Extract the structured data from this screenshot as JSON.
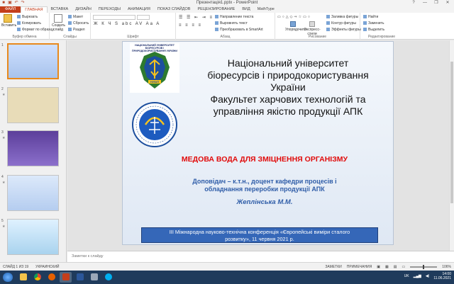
{
  "window": {
    "title": "Презентація1.pptx - PowerPoint",
    "help": "?",
    "min": "—",
    "max": "❐",
    "close": "✕"
  },
  "tabs": [
    "ФАЙЛ",
    "ГЛАВНАЯ",
    "ВСТАВКА",
    "ДИЗАЙН",
    "ПЕРЕХОДЫ",
    "АНИМАЦИЯ",
    "ПОКАЗ СЛАЙДОВ",
    "РЕЦЕНЗИРОВАНИЕ",
    "ВИД",
    "MathType"
  ],
  "ribbon": {
    "clipboard": {
      "paste": "Вставить",
      "cut": "Вырезать",
      "copy": "Копировать",
      "format": "Формат по образцу",
      "label": "Буфер обмена"
    },
    "slides": {
      "new_slide": "Создать слайд",
      "layout": "Макет",
      "reset": "Сбросить",
      "section": "Раздел",
      "label": "Слайды"
    },
    "font": {
      "label": "Шрифт",
      "format_row": "Ж К Ч S abc AV Aa A"
    },
    "paragraph": {
      "direction": "Направление текста",
      "align": "Выровнять текст",
      "smartart": "Преобразовать в SmartArt",
      "label": "Абзац"
    },
    "drawing": {
      "arrange": "Упорядочить",
      "styles": "Экспресс-стили",
      "fill": "Заливка фигуры",
      "outline": "Контур фигуры",
      "effects": "Эффекты фигуры",
      "label": "Рисование"
    },
    "editing": {
      "find": "Найти",
      "replace": "Заменить",
      "select": "Выделить",
      "label": "Редактирование"
    }
  },
  "thumbnails": [
    {
      "num": "1",
      "star": ""
    },
    {
      "num": "2",
      "star": "★"
    },
    {
      "num": "3",
      "star": "★"
    },
    {
      "num": "4",
      "star": "★"
    },
    {
      "num": "5",
      "star": "★"
    }
  ],
  "slide": {
    "logo1_text": "НАЦІОНАЛЬНИЙ УНІВЕРСИТЕТ БІОРЕСУРСІВ І ПРИРОДОКОРИСТУВАННЯ УКРАЇНИ",
    "logo1_badge": "НУБіП",
    "title_lines": [
      "Національний університет",
      "біоресурсів і природокористування",
      "України",
      "Факультет харчових технологій та",
      "управління якістю продукції АПК"
    ],
    "topic": "МЕДОВА ВОДА ДЛЯ ЗМІЦНЕННЯ ОРГАНІЗМУ",
    "speaker_lines": [
      "Доповідач – к.т.н., доцент кафедри процесів і",
      "обладнання переробки продукції АПК"
    ],
    "speaker_name": "Жеплінська М.М.",
    "conference_lines": [
      "ІІІ Міжнародна науково-технічна конференція «Європейські виміри сталого",
      "розвитку», 11 червня 2021 р."
    ]
  },
  "notes_placeholder": "Заметки к слайду",
  "status": {
    "slide": "СЛАЙД 1 ИЗ 19",
    "language": "УКРАИНСКИЙ",
    "notes_btn": "ЗАМЕТКИ",
    "comments_btn": "ПРИМЕЧАНИЯ",
    "zoom": "106%"
  },
  "taskbar": {
    "lang": "UK",
    "time": "14:00",
    "date": "11.06.2021"
  },
  "colors": {
    "accent": "#c43e1c",
    "topic": "#e10b0b",
    "speaker": "#2f5da8",
    "conference_box": "#3567b8"
  }
}
